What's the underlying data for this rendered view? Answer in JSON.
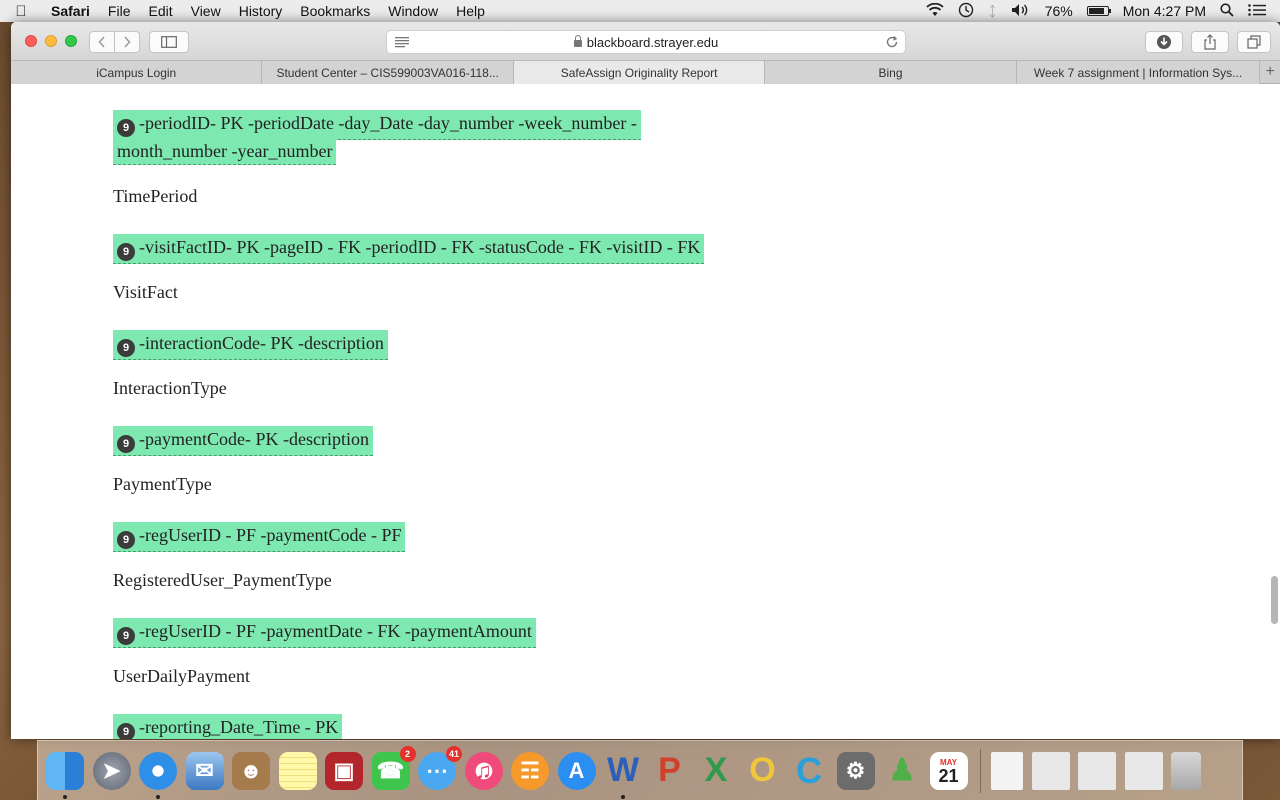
{
  "menubar": {
    "app": "Safari",
    "items": [
      "File",
      "Edit",
      "View",
      "History",
      "Bookmarks",
      "Window",
      "Help"
    ],
    "battery": "76%",
    "clock": "Mon 4:27 PM"
  },
  "browser": {
    "url": "blackboard.strayer.edu",
    "tabs": [
      {
        "label": "iCampus Login"
      },
      {
        "label": "Student Center – CIS599003VA016-118..."
      },
      {
        "label": "SafeAssign Originality Report"
      },
      {
        "label": "Bing"
      },
      {
        "label": "Week 7 assignment | Information Sys..."
      }
    ],
    "active_tab": 2
  },
  "report": {
    "badge": "9",
    "blocks": [
      {
        "match": "-periodID- PK -periodDate -day_Date -day_number -week_number -",
        "match2": "month_number -year_number",
        "label": "TimePeriod"
      },
      {
        "match": "-visitFactID- PK -pageID - FK -periodID - FK -statusCode - FK -visitID - FK",
        "label": "VisitFact"
      },
      {
        "match": "-interactionCode- PK -description",
        "label": "InteractionType"
      },
      {
        "match": "-paymentCode- PK -description",
        "label": "PaymentType"
      },
      {
        "match": "-regUserID - PF -paymentCode - PF",
        "label": "RegisteredUser_PaymentType"
      },
      {
        "match": "-regUserID - PF -paymentDate - FK -paymentAmount",
        "label": "UserDailyPayment"
      },
      {
        "match": "-reporting_Date_Time - PK"
      }
    ]
  },
  "dock": {
    "facetime_badge": "2",
    "messages_badge": "41",
    "calendar_month": "MAY",
    "calendar_day": "21",
    "icons": [
      "finder-icon",
      "launchpad-icon",
      "safari-icon",
      "mail-icon",
      "contacts-icon",
      "notes-icon",
      "photo-booth-icon",
      "facetime-icon",
      "messages-icon",
      "itunes-icon",
      "ibooks-icon",
      "app-store-icon",
      "word-icon",
      "powerpoint-icon",
      "excel-icon",
      "outlook-icon",
      "c-app-icon",
      "system-preferences-icon",
      "messenger-icon",
      "calendar-icon"
    ]
  }
}
